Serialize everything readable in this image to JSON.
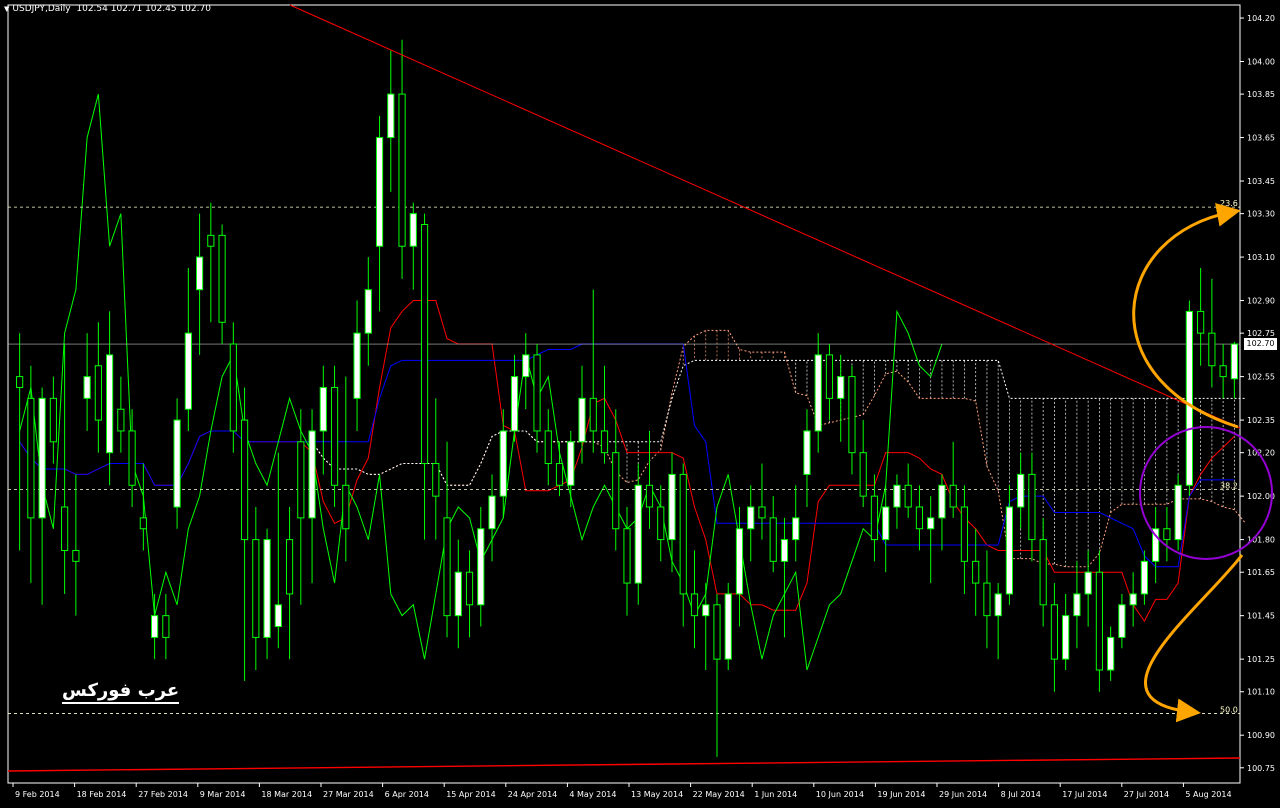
{
  "header": {
    "symbol_label": "USDJPY,Daily",
    "ohlc_label": "102.54 102.71 102.45 102.70"
  },
  "watermark": "عرب فوركس",
  "current_price_label": "102.70",
  "colors": {
    "background": "#000000",
    "bull_candle": "#ffffff",
    "candle_outline": "#00ff00",
    "tenkan": "#ff0000",
    "kijun": "#0000ff",
    "chikou": "#00ff00",
    "cloud_a": "#ffa07a",
    "cloud_b": "#ffffff",
    "fib_line": "#ffffcc",
    "trendline": "#ff0000",
    "annotation_arrow": "#ffa500",
    "annotation_circle": "#9400d3"
  },
  "chart_data": {
    "type": "candlestick",
    "ylim": [
      100.68,
      104.26
    ],
    "y_ticks": [
      "104.20",
      "104.00",
      "103.85",
      "103.65",
      "103.45",
      "103.30",
      "103.10",
      "102.90",
      "102.75",
      "102.55",
      "102.35",
      "102.20",
      "102.00",
      "101.80",
      "101.65",
      "101.45",
      "101.25",
      "101.10",
      "100.90",
      "100.75"
    ],
    "x_labels": [
      "9 Feb 2014",
      "18 Feb 2014",
      "27 Feb 2014",
      "9 Mar 2014",
      "18 Mar 2014",
      "27 Mar 2014",
      "6 Apr 2014",
      "15 Apr 2014",
      "24 Apr 2014",
      "4 May 2014",
      "13 May 2014",
      "22 May 2014",
      "1 Jun 2014",
      "10 Jun 2014",
      "19 Jun 2014",
      "29 Jun 2014",
      "8 Jul 2014",
      "17 Jul 2014",
      "27 Jul 2014",
      "5 Aug 2014"
    ],
    "current_price": 102.7,
    "fib_levels": [
      {
        "label": "23.6",
        "value": 103.33
      },
      {
        "label": "38.2",
        "value": 102.03
      },
      {
        "label": "50.0",
        "value": 101.0
      }
    ],
    "candles": [
      {
        "o": 102.55,
        "h": 102.75,
        "l": 101.75,
        "c": 102.5
      },
      {
        "o": 102.45,
        "h": 102.6,
        "l": 101.6,
        "c": 101.9
      },
      {
        "o": 101.9,
        "h": 102.5,
        "l": 101.5,
        "c": 102.45
      },
      {
        "o": 102.45,
        "h": 102.55,
        "l": 102.15,
        "c": 102.25
      },
      {
        "o": 101.95,
        "h": 102.7,
        "l": 101.55,
        "c": 101.75
      },
      {
        "o": 101.75,
        "h": 102.1,
        "l": 101.45,
        "c": 101.7
      },
      {
        "o": 102.45,
        "h": 102.75,
        "l": 102.3,
        "c": 102.55
      },
      {
        "o": 102.6,
        "h": 102.8,
        "l": 102.2,
        "c": 102.35
      },
      {
        "o": 102.2,
        "h": 102.85,
        "l": 102.05,
        "c": 102.65
      },
      {
        "o": 102.4,
        "h": 102.55,
        "l": 102.2,
        "c": 102.3
      },
      {
        "o": 102.3,
        "h": 102.4,
        "l": 101.95,
        "c": 102.05
      },
      {
        "o": 101.9,
        "h": 102.15,
        "l": 101.75,
        "c": 101.85
      },
      {
        "o": 101.35,
        "h": 101.55,
        "l": 101.25,
        "c": 101.45
      },
      {
        "o": 101.45,
        "h": 101.55,
        "l": 101.25,
        "c": 101.35
      },
      {
        "o": 101.95,
        "h": 102.45,
        "l": 101.85,
        "c": 102.35
      },
      {
        "o": 102.4,
        "h": 103.05,
        "l": 102.3,
        "c": 102.75
      },
      {
        "o": 102.95,
        "h": 103.3,
        "l": 102.65,
        "c": 103.1
      },
      {
        "o": 103.2,
        "h": 103.35,
        "l": 102.8,
        "c": 103.15
      },
      {
        "o": 103.2,
        "h": 103.25,
        "l": 102.7,
        "c": 102.8
      },
      {
        "o": 102.7,
        "h": 102.8,
        "l": 102.2,
        "c": 102.3
      },
      {
        "o": 102.35,
        "h": 102.5,
        "l": 101.15,
        "c": 101.8
      },
      {
        "o": 101.8,
        "h": 101.95,
        "l": 101.2,
        "c": 101.35
      },
      {
        "o": 101.35,
        "h": 101.85,
        "l": 101.25,
        "c": 101.8
      },
      {
        "o": 101.4,
        "h": 102.2,
        "l": 101.3,
        "c": 101.5
      },
      {
        "o": 101.8,
        "h": 101.95,
        "l": 101.25,
        "c": 101.55
      },
      {
        "o": 102.25,
        "h": 102.4,
        "l": 101.5,
        "c": 101.9
      },
      {
        "o": 101.9,
        "h": 102.4,
        "l": 101.6,
        "c": 102.3
      },
      {
        "o": 102.3,
        "h": 102.6,
        "l": 102.1,
        "c": 102.5
      },
      {
        "o": 102.5,
        "h": 102.6,
        "l": 101.95,
        "c": 102.05
      },
      {
        "o": 102.05,
        "h": 102.55,
        "l": 101.7,
        "c": 101.85
      },
      {
        "o": 102.45,
        "h": 102.9,
        "l": 102.3,
        "c": 102.75
      },
      {
        "o": 102.75,
        "h": 103.1,
        "l": 102.6,
        "c": 102.95
      },
      {
        "o": 103.15,
        "h": 103.75,
        "l": 102.85,
        "c": 103.65
      },
      {
        "o": 103.65,
        "h": 104.05,
        "l": 103.4,
        "c": 103.85
      },
      {
        "o": 103.85,
        "h": 104.1,
        "l": 103.0,
        "c": 103.15
      },
      {
        "o": 103.15,
        "h": 103.35,
        "l": 102.95,
        "c": 103.3
      },
      {
        "o": 103.25,
        "h": 103.3,
        "l": 101.8,
        "c": 102.15
      },
      {
        "o": 102.15,
        "h": 102.45,
        "l": 101.8,
        "c": 102.0
      },
      {
        "o": 101.9,
        "h": 102.25,
        "l": 101.35,
        "c": 101.45
      },
      {
        "o": 101.45,
        "h": 101.8,
        "l": 101.3,
        "c": 101.65
      },
      {
        "o": 101.65,
        "h": 101.75,
        "l": 101.35,
        "c": 101.5
      },
      {
        "o": 101.5,
        "h": 101.95,
        "l": 101.4,
        "c": 101.85
      },
      {
        "o": 101.85,
        "h": 102.1,
        "l": 101.7,
        "c": 102.0
      },
      {
        "o": 102.0,
        "h": 102.4,
        "l": 101.9,
        "c": 102.3
      },
      {
        "o": 102.3,
        "h": 102.65,
        "l": 102.25,
        "c": 102.55
      },
      {
        "o": 102.55,
        "h": 102.75,
        "l": 102.4,
        "c": 102.65
      },
      {
        "o": 102.65,
        "h": 102.7,
        "l": 102.2,
        "c": 102.3
      },
      {
        "o": 102.3,
        "h": 102.4,
        "l": 102.05,
        "c": 102.15
      },
      {
        "o": 102.15,
        "h": 102.25,
        "l": 102.0,
        "c": 102.05
      },
      {
        "o": 102.05,
        "h": 102.3,
        "l": 101.95,
        "c": 102.25
      },
      {
        "o": 102.25,
        "h": 102.6,
        "l": 102.15,
        "c": 102.45
      },
      {
        "o": 102.45,
        "h": 102.95,
        "l": 102.2,
        "c": 102.3
      },
      {
        "o": 102.3,
        "h": 102.6,
        "l": 102.15,
        "c": 102.2
      },
      {
        "o": 102.2,
        "h": 102.4,
        "l": 101.75,
        "c": 101.85
      },
      {
        "o": 101.85,
        "h": 101.95,
        "l": 101.45,
        "c": 101.6
      },
      {
        "o": 101.6,
        "h": 102.15,
        "l": 101.5,
        "c": 102.05
      },
      {
        "o": 102.05,
        "h": 102.3,
        "l": 101.85,
        "c": 101.95
      },
      {
        "o": 101.95,
        "h": 102.05,
        "l": 101.7,
        "c": 101.8
      },
      {
        "o": 101.8,
        "h": 102.2,
        "l": 101.65,
        "c": 102.1
      },
      {
        "o": 102.1,
        "h": 102.15,
        "l": 101.4,
        "c": 101.55
      },
      {
        "o": 101.55,
        "h": 101.75,
        "l": 101.3,
        "c": 101.45
      },
      {
        "o": 101.45,
        "h": 101.6,
        "l": 101.2,
        "c": 101.5
      },
      {
        "o": 101.5,
        "h": 101.55,
        "l": 100.8,
        "c": 101.25
      },
      {
        "o": 101.25,
        "h": 101.6,
        "l": 101.2,
        "c": 101.55
      },
      {
        "o": 101.55,
        "h": 101.95,
        "l": 101.4,
        "c": 101.85
      },
      {
        "o": 101.85,
        "h": 102.05,
        "l": 101.7,
        "c": 101.95
      },
      {
        "o": 101.95,
        "h": 102.15,
        "l": 101.8,
        "c": 101.9
      },
      {
        "o": 101.9,
        "h": 102.0,
        "l": 101.65,
        "c": 101.7
      },
      {
        "o": 101.7,
        "h": 101.9,
        "l": 101.35,
        "c": 101.8
      },
      {
        "o": 101.8,
        "h": 102.05,
        "l": 101.7,
        "c": 101.9
      },
      {
        "o": 102.1,
        "h": 102.4,
        "l": 101.95,
        "c": 102.3
      },
      {
        "o": 102.3,
        "h": 102.75,
        "l": 102.2,
        "c": 102.65
      },
      {
        "o": 102.65,
        "h": 102.7,
        "l": 102.35,
        "c": 102.45
      },
      {
        "o": 102.45,
        "h": 102.65,
        "l": 102.25,
        "c": 102.55
      },
      {
        "o": 102.55,
        "h": 102.6,
        "l": 102.1,
        "c": 102.2
      },
      {
        "o": 102.2,
        "h": 102.35,
        "l": 101.95,
        "c": 102.0
      },
      {
        "o": 102.0,
        "h": 102.1,
        "l": 101.7,
        "c": 101.8
      },
      {
        "o": 101.8,
        "h": 102.05,
        "l": 101.65,
        "c": 101.95
      },
      {
        "o": 101.95,
        "h": 102.1,
        "l": 101.85,
        "c": 102.05
      },
      {
        "o": 102.05,
        "h": 102.15,
        "l": 101.9,
        "c": 101.95
      },
      {
        "o": 101.95,
        "h": 102.05,
        "l": 101.75,
        "c": 101.85
      },
      {
        "o": 101.85,
        "h": 102.0,
        "l": 101.6,
        "c": 101.9
      },
      {
        "o": 101.9,
        "h": 102.1,
        "l": 101.75,
        "c": 102.05
      },
      {
        "o": 102.05,
        "h": 102.25,
        "l": 101.9,
        "c": 101.95
      },
      {
        "o": 101.95,
        "h": 102.05,
        "l": 101.55,
        "c": 101.7
      },
      {
        "o": 101.7,
        "h": 101.85,
        "l": 101.45,
        "c": 101.6
      },
      {
        "o": 101.6,
        "h": 101.75,
        "l": 101.3,
        "c": 101.45
      },
      {
        "o": 101.45,
        "h": 101.6,
        "l": 101.25,
        "c": 101.55
      },
      {
        "o": 101.55,
        "h": 102.05,
        "l": 101.5,
        "c": 101.95
      },
      {
        "o": 101.95,
        "h": 102.2,
        "l": 101.85,
        "c": 102.1
      },
      {
        "o": 102.1,
        "h": 102.2,
        "l": 101.7,
        "c": 101.8
      },
      {
        "o": 101.8,
        "h": 101.9,
        "l": 101.4,
        "c": 101.5
      },
      {
        "o": 101.5,
        "h": 101.6,
        "l": 101.1,
        "c": 101.25
      },
      {
        "o": 101.25,
        "h": 101.55,
        "l": 101.2,
        "c": 101.45
      },
      {
        "o": 101.45,
        "h": 101.7,
        "l": 101.3,
        "c": 101.55
      },
      {
        "o": 101.55,
        "h": 101.75,
        "l": 101.4,
        "c": 101.65
      },
      {
        "o": 101.65,
        "h": 101.75,
        "l": 101.1,
        "c": 101.2
      },
      {
        "o": 101.2,
        "h": 101.4,
        "l": 101.15,
        "c": 101.35
      },
      {
        "o": 101.35,
        "h": 101.55,
        "l": 101.3,
        "c": 101.5
      },
      {
        "o": 101.5,
        "h": 101.65,
        "l": 101.4,
        "c": 101.55
      },
      {
        "o": 101.55,
        "h": 101.75,
        "l": 101.5,
        "c": 101.7
      },
      {
        "o": 101.7,
        "h": 101.95,
        "l": 101.6,
        "c": 101.85
      },
      {
        "o": 101.85,
        "h": 101.95,
        "l": 101.7,
        "c": 101.8
      },
      {
        "o": 101.8,
        "h": 102.1,
        "l": 101.75,
        "c": 102.05
      },
      {
        "o": 102.05,
        "h": 102.9,
        "l": 102.0,
        "c": 102.85
      },
      {
        "o": 102.85,
        "h": 103.05,
        "l": 102.6,
        "c": 102.75
      },
      {
        "o": 102.75,
        "h": 103.0,
        "l": 102.5,
        "c": 102.6
      },
      {
        "o": 102.6,
        "h": 102.7,
        "l": 102.45,
        "c": 102.55
      },
      {
        "o": 102.54,
        "h": 102.71,
        "l": 102.45,
        "c": 102.7
      }
    ]
  }
}
